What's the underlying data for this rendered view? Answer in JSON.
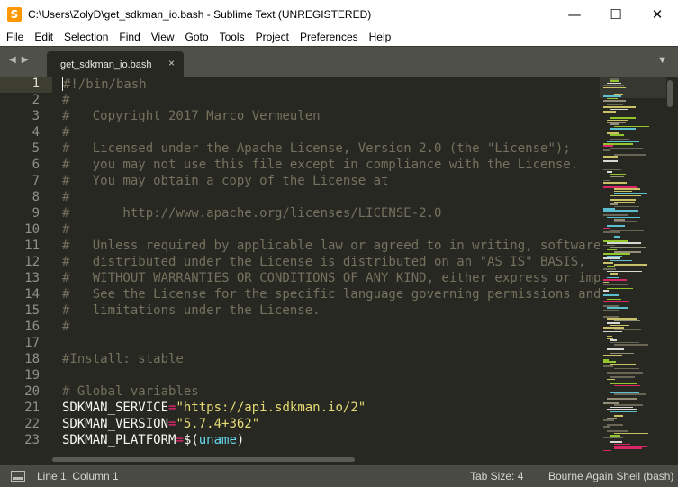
{
  "window": {
    "title": "C:\\Users\\ZolyD\\get_sdkman_io.bash - Sublime Text (UNREGISTERED)",
    "app_icon": "sublime-text-icon",
    "controls": {
      "minimize": "—",
      "maximize": "☐",
      "close": "✕"
    }
  },
  "menu": {
    "items": [
      "File",
      "Edit",
      "Selection",
      "Find",
      "View",
      "Goto",
      "Tools",
      "Project",
      "Preferences",
      "Help"
    ]
  },
  "tabs": {
    "nav_back": "◀",
    "nav_forward": "▶",
    "active": {
      "label": "get_sdkman_io.bash",
      "close": "×"
    },
    "dropdown": "▼"
  },
  "editor": {
    "line_numbers": [
      "1",
      "2",
      "3",
      "4",
      "5",
      "6",
      "7",
      "8",
      "9",
      "10",
      "11",
      "12",
      "13",
      "14",
      "15",
      "16",
      "17",
      "18",
      "19",
      "20",
      "21",
      "22",
      "23"
    ],
    "active_line": 1,
    "lines": [
      [
        {
          "t": "#!/bin/bash",
          "c": "comment"
        }
      ],
      [
        {
          "t": "#",
          "c": "comment"
        }
      ],
      [
        {
          "t": "#   Copyright 2017 Marco Vermeulen",
          "c": "comment"
        }
      ],
      [
        {
          "t": "#",
          "c": "comment"
        }
      ],
      [
        {
          "t": "#   Licensed under the Apache License, Version 2.0 (the \"License\");",
          "c": "comment"
        }
      ],
      [
        {
          "t": "#   you may not use this file except in compliance with the License.",
          "c": "comment"
        }
      ],
      [
        {
          "t": "#   You may obtain a copy of the License at",
          "c": "comment"
        }
      ],
      [
        {
          "t": "#",
          "c": "comment"
        }
      ],
      [
        {
          "t": "#       http://www.apache.org/licenses/LICENSE-2.0",
          "c": "comment"
        }
      ],
      [
        {
          "t": "#",
          "c": "comment"
        }
      ],
      [
        {
          "t": "#   Unless required by applicable law or agreed to in writing, software",
          "c": "comment"
        }
      ],
      [
        {
          "t": "#   distributed under the License is distributed on an \"AS IS\" BASIS,",
          "c": "comment"
        }
      ],
      [
        {
          "t": "#   WITHOUT WARRANTIES OR CONDITIONS OF ANY KIND, either express or impli",
          "c": "comment"
        }
      ],
      [
        {
          "t": "#   See the License for the specific language governing permissions and",
          "c": "comment"
        }
      ],
      [
        {
          "t": "#   limitations under the License.",
          "c": "comment"
        }
      ],
      [
        {
          "t": "#",
          "c": "comment"
        }
      ],
      [],
      [
        {
          "t": "#Install: stable",
          "c": "comment"
        }
      ],
      [],
      [
        {
          "t": "# Global variables",
          "c": "comment"
        }
      ],
      [
        {
          "t": "SDKMAN_SERVICE",
          "c": "var"
        },
        {
          "t": "=",
          "c": "op"
        },
        {
          "t": "\"https://api.sdkman.io/2\"",
          "c": "str"
        }
      ],
      [
        {
          "t": "SDKMAN_VERSION",
          "c": "var"
        },
        {
          "t": "=",
          "c": "op"
        },
        {
          "t": "\"5.7.4+362\"",
          "c": "str"
        }
      ],
      [
        {
          "t": "SDKMAN_PLATFORM",
          "c": "var"
        },
        {
          "t": "=",
          "c": "op"
        },
        {
          "t": "$(",
          "c": "var"
        },
        {
          "t": "uname",
          "c": "func"
        },
        {
          "t": ")",
          "c": "var"
        }
      ]
    ]
  },
  "status": {
    "panel_icon": "panel-toggle-icon",
    "position": "Line 1, Column 1",
    "tab_size": "Tab Size: 4",
    "syntax": "Bourne Again Shell (bash)"
  },
  "colors": {
    "editor_bg": "#272822",
    "comment": "#75715e",
    "string": "#e6db74",
    "operator": "#f92672",
    "function": "#66d9ef",
    "status_bg": "#4a4a45",
    "tabbar_bg": "#50504a"
  }
}
